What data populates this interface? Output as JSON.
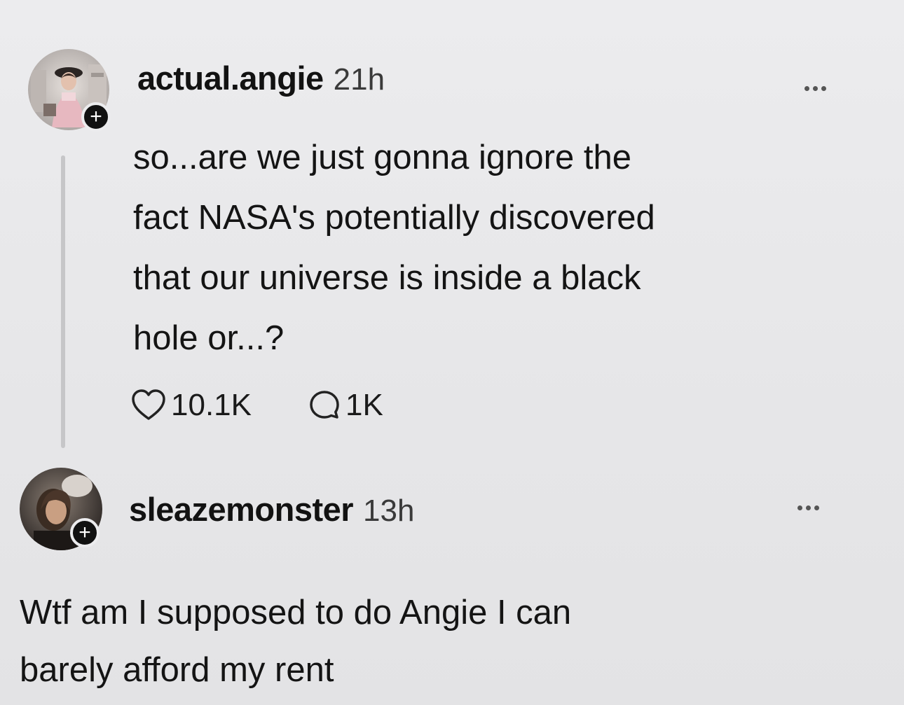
{
  "posts": [
    {
      "username": "actual.angie",
      "time": "21h",
      "text": "so...are we just gonna ignore the\nfact NASA's potentially discovered\nthat our universe is inside a black\nhole or...?",
      "likes": "10.1K",
      "replies": "1K",
      "follow_label": "+",
      "avatar_icon": "profile-photo"
    },
    {
      "username": "sleazemonster",
      "time": "13h",
      "text": "Wtf am I supposed to do Angie I can\nbarely afford my rent",
      "follow_label": "+",
      "avatar_icon": "profile-photo"
    }
  ],
  "icons": {
    "more": "more-horizontal-icon",
    "like": "heart-icon",
    "reply": "comment-icon"
  },
  "colors": {
    "background": "#e9e9eb",
    "text": "#111111",
    "thread_line": "#c6c6c8",
    "badge": "#111111"
  }
}
